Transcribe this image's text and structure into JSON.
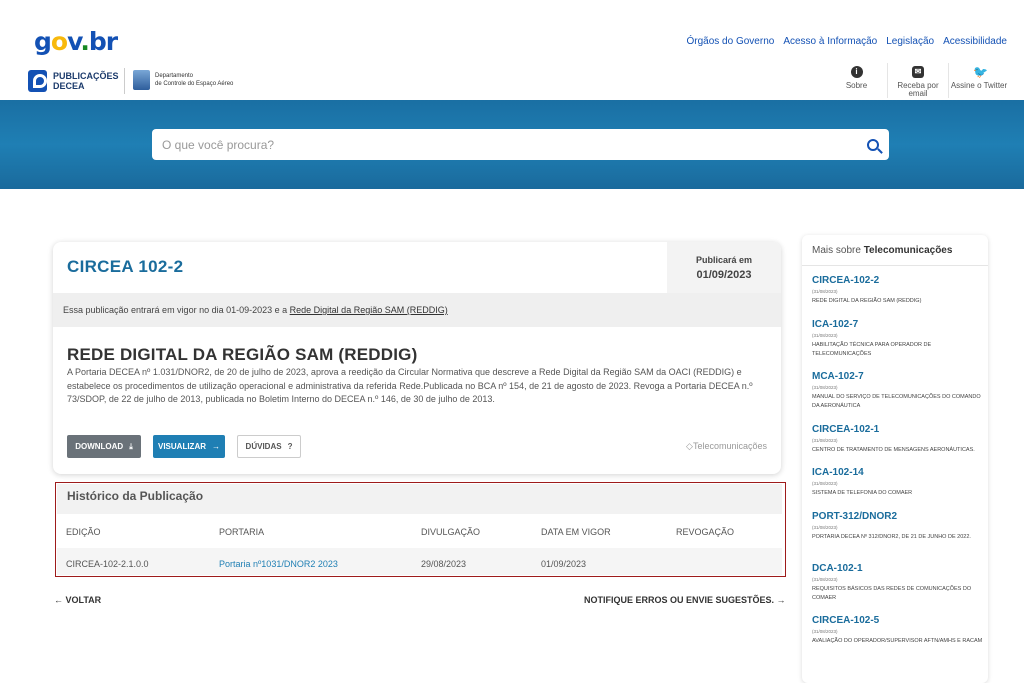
{
  "header": {
    "logo": [
      "g",
      "o",
      "v",
      ".",
      "b",
      "r"
    ],
    "links": [
      "Órgãos do Governo",
      "Acesso à Informação",
      "Legislação",
      "Acessibilidade"
    ],
    "pub_logo": [
      "PUBLICAÇÕES",
      "DECEA"
    ],
    "dep_logo": [
      "Departamento",
      "de Controle do Espaço Aéreo"
    ],
    "tools": [
      {
        "label": "Sobre",
        "icon": "info-icon"
      },
      {
        "label": "Receba por email",
        "icon": "email-icon"
      },
      {
        "label": "Assine o Twitter",
        "icon": "twitter-icon"
      }
    ]
  },
  "search": {
    "placeholder": "O que você procura?"
  },
  "publication": {
    "code": "CIRCEA 102-2",
    "publish_label": "Publicará em",
    "publish_date": "01/09/2023",
    "notice_prefix": "Essa publicação entrará em vigor no dia 01-09-2023 e a",
    "notice_link": "Rede Digital da Região SAM (REDDIG)",
    "title": "REDE DIGITAL DA REGIÃO SAM (REDDIG)",
    "description": "A Portaria DECEA nº 1.031/DNOR2, de 20 de julho de 2023, aprova  a reedição da Circular Normativa que descreve a Rede Digital da Região SAM da OACI (REDDIG) e estabelece os procedimentos de utilização operacional e administrativa da referida Rede.Publicada no BCA nº 154, de 21 de agosto de 2023. Revoga a Portaria DECEA n.º 73/SDOP, de 22 de julho de 2013, publicada no Boletim Interno do DECEA n.º 146, de 30 de julho de 2013.",
    "buttons": {
      "download": "DOWNLOAD",
      "visualizar": "VISUALIZAR",
      "duvidas": "DÚVIDAS"
    },
    "tag": "Telecomunicações"
  },
  "history": {
    "title": "Histórico da Publicação",
    "columns": [
      "EDIÇÃO",
      "PORTARIA",
      "DIVULGAÇÃO",
      "DATA EM VIGOR",
      "REVOGAÇÃO"
    ],
    "rows": [
      {
        "edicao": "CIRCEA-102-2.1.0.0",
        "portaria": "Portaria nº1031/DNOR2 2023",
        "divulgacao": "29/08/2023",
        "vigor": "01/09/2023",
        "revogacao": ""
      }
    ]
  },
  "footer_nav": {
    "back": "VOLTAR",
    "notify": "NOTIFIQUE ERROS OU ENVIE SUGESTÕES."
  },
  "sidebar": {
    "title_prefix": "Mais sobre",
    "title_topic": "Telecomunicações",
    "items": [
      {
        "name": "CIRCEA-102-2",
        "date": "(31/08/2023)",
        "desc": "REDE DIGITAL DA REGIÃO SAM (REDDIG)"
      },
      {
        "name": "ICA-102-7",
        "date": "(31/08/2023)",
        "desc": "HABILITAÇÃO TÉCNICA PARA OPERADOR DE TELECOMUNICAÇÕES"
      },
      {
        "name": "MCA-102-7",
        "date": "(31/08/2023)",
        "desc": "MANUAL DO SERVIÇO DE TELECOMUNICAÇÕES DO COMANDO DA AERONÁUTICA"
      },
      {
        "name": "CIRCEA-102-1",
        "date": "(31/08/2023)",
        "desc": "CENTRO DE TRATAMENTO DE MENSAGENS AERONÁUTICAS."
      },
      {
        "name": "ICA-102-14",
        "date": "(31/08/2023)",
        "desc": "SISTEMA DE TELEFONIA DO COMAER"
      },
      {
        "name": "PORT-312/DNOR2",
        "date": "(31/08/2023)",
        "desc": "PORTARIA DECEA nº 312/DNOR2, DE 21 DE JUNHO DE 2022."
      },
      {
        "name": "DCA-102-1",
        "date": "(31/08/2023)",
        "desc": "REQUISITOS BÁSICOS DAS REDES DE COMUNICAÇÕES DO COMAER"
      },
      {
        "name": "CIRCEA-102-5",
        "date": "(31/08/2023)",
        "desc": "AVALIAÇÃO DO OPERADOR/SUPERVISOR AFTN/AMHS E RACAM"
      }
    ]
  }
}
